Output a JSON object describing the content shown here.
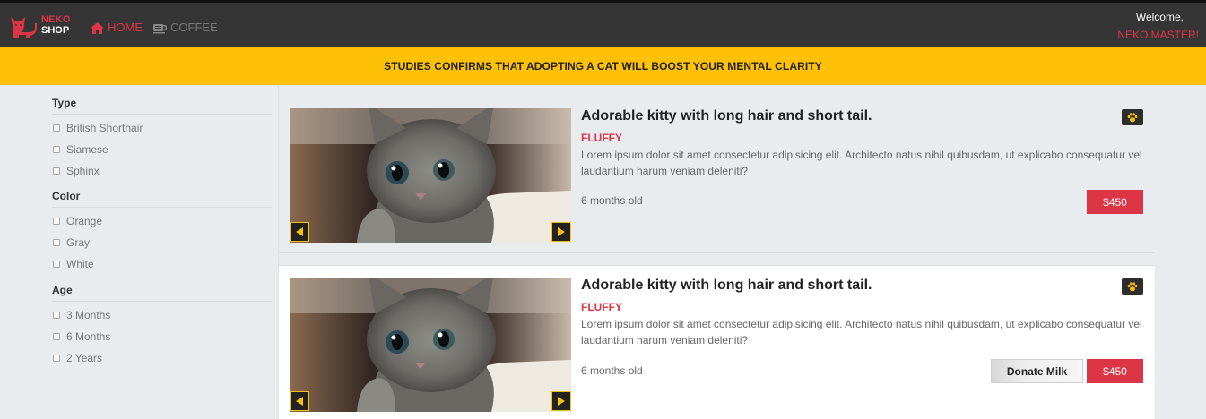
{
  "header": {
    "brand_line1": "NEKO",
    "brand_line2": "SHOP",
    "nav": [
      {
        "label": "HOME",
        "icon": "home-icon",
        "active": true
      },
      {
        "label": "COFFEE",
        "icon": "coffee-icon",
        "active": false
      }
    ],
    "welcome": "Welcome,",
    "username": "NEKO MASTER!"
  },
  "banner": {
    "text": "STUDIES CONFIRMS THAT ADOPTING A CAT WILL BOOST YOUR MENTAL CLARITY"
  },
  "filters": [
    {
      "title": "Type",
      "options": [
        "British Shorthair",
        "Siamese",
        "Sphinx"
      ]
    },
    {
      "title": "Color",
      "options": [
        "Orange",
        "Gray",
        "White"
      ]
    },
    {
      "title": "Age",
      "options": [
        "3 Months",
        "6 Months",
        "2 Years"
      ]
    }
  ],
  "products": [
    {
      "title": "Adorable kitty with long hair and short tail.",
      "tag": "FLUFFY",
      "description": "Lorem ipsum dolor sit amet consectetur adipisicing elit. Architecto natus nihil quibusdam, ut explicabo consequatur vel laudantium harum veniam deleniti?",
      "age": "6 months old",
      "price": "$450",
      "donate": ""
    },
    {
      "title": "Adorable kitty with long hair and short tail.",
      "tag": "FLUFFY",
      "description": "Lorem ipsum dolor sit amet consectetur adipisicing elit. Architecto natus nihil quibusdam, ut explicabo consequatur vel laudantium harum veniam deleniti?",
      "age": "6 months old",
      "price": "$450",
      "donate": "Donate Milk"
    }
  ],
  "colors": {
    "accent": "#dc3545",
    "banner": "#ffc107",
    "nav_bg": "#353535"
  }
}
